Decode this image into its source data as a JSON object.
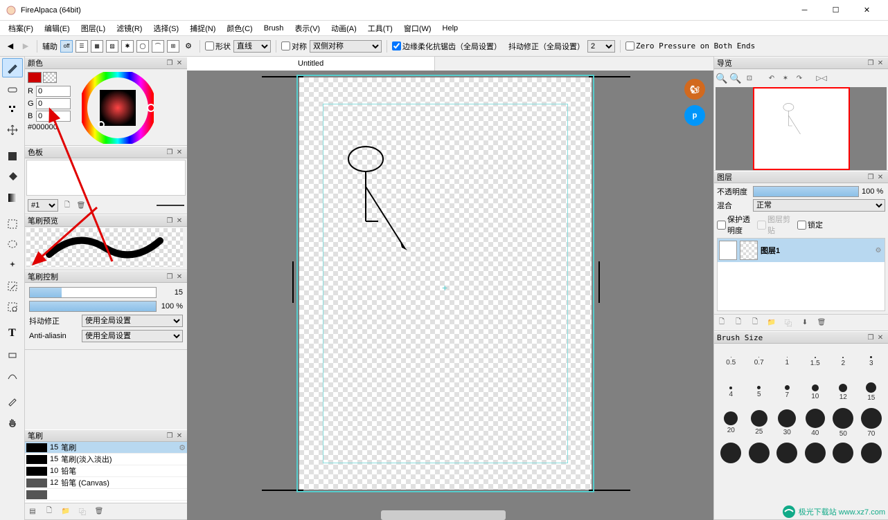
{
  "window": {
    "title": "FireAlpaca (64bit)"
  },
  "menu": [
    "档案(F)",
    "编辑(E)",
    "图层(L)",
    "滤镜(R)",
    "选择(S)",
    "捕捉(N)",
    "颜色(C)",
    "Brush",
    "表示(V)",
    "动画(A)",
    "工具(T)",
    "窗口(W)",
    "Help"
  ],
  "toolbar": {
    "assist": "辅助",
    "off": "off",
    "shape": "形状",
    "shape_sel": "直线",
    "symmetry": "对称",
    "sym_sel": "双侧对称",
    "antialias": "边缘柔化抗锯齿（全局设置）",
    "shake": "抖动修正（全局设置）",
    "shake_val": "2",
    "zeropressure": "Zero Pressure on Both Ends"
  },
  "color": {
    "title": "颜色",
    "r": "0",
    "g": "0",
    "b": "0",
    "hex": "#000000"
  },
  "palette": {
    "title": "色板",
    "preset": "#1"
  },
  "brushprev": {
    "title": "笔刷预览"
  },
  "brushctrl": {
    "title": "笔刷控制",
    "size": "15",
    "opacity": "100 %",
    "shake_lbl": "抖动修正",
    "shake_val": "使用全局设置",
    "aa_lbl": "Anti-aliasin",
    "aa_val": "使用全局设置"
  },
  "brushes": {
    "title": "笔刷",
    "items": [
      {
        "size": "15",
        "name": "笔刷",
        "sel": true
      },
      {
        "size": "15",
        "name": "笔刷(淡入淡出)"
      },
      {
        "size": "10",
        "name": "铅笔"
      },
      {
        "size": "12",
        "name": "铅笔 (Canvas)"
      },
      {
        "size": "",
        "name": ""
      }
    ]
  },
  "canvas": {
    "tab": "Untitled"
  },
  "nav": {
    "title": "导览"
  },
  "layers": {
    "title": "图层",
    "opacity_lbl": "不透明度",
    "opacity": "100 %",
    "blend_lbl": "混合",
    "blend": "正常",
    "protect": "保护透明度",
    "clip": "图层剪贴",
    "lock": "锁定",
    "layer1": "图层1"
  },
  "brushsize": {
    "title": "Brush Size",
    "rows": [
      [
        "0.5",
        "0.7",
        "1",
        "1.5",
        "2",
        "3"
      ],
      [
        "4",
        "5",
        "7",
        "10",
        "12",
        "15"
      ],
      [
        "20",
        "25",
        "30",
        "40",
        "50",
        "70"
      ]
    ]
  },
  "watermark": "极光下载站  www.xz7.com"
}
